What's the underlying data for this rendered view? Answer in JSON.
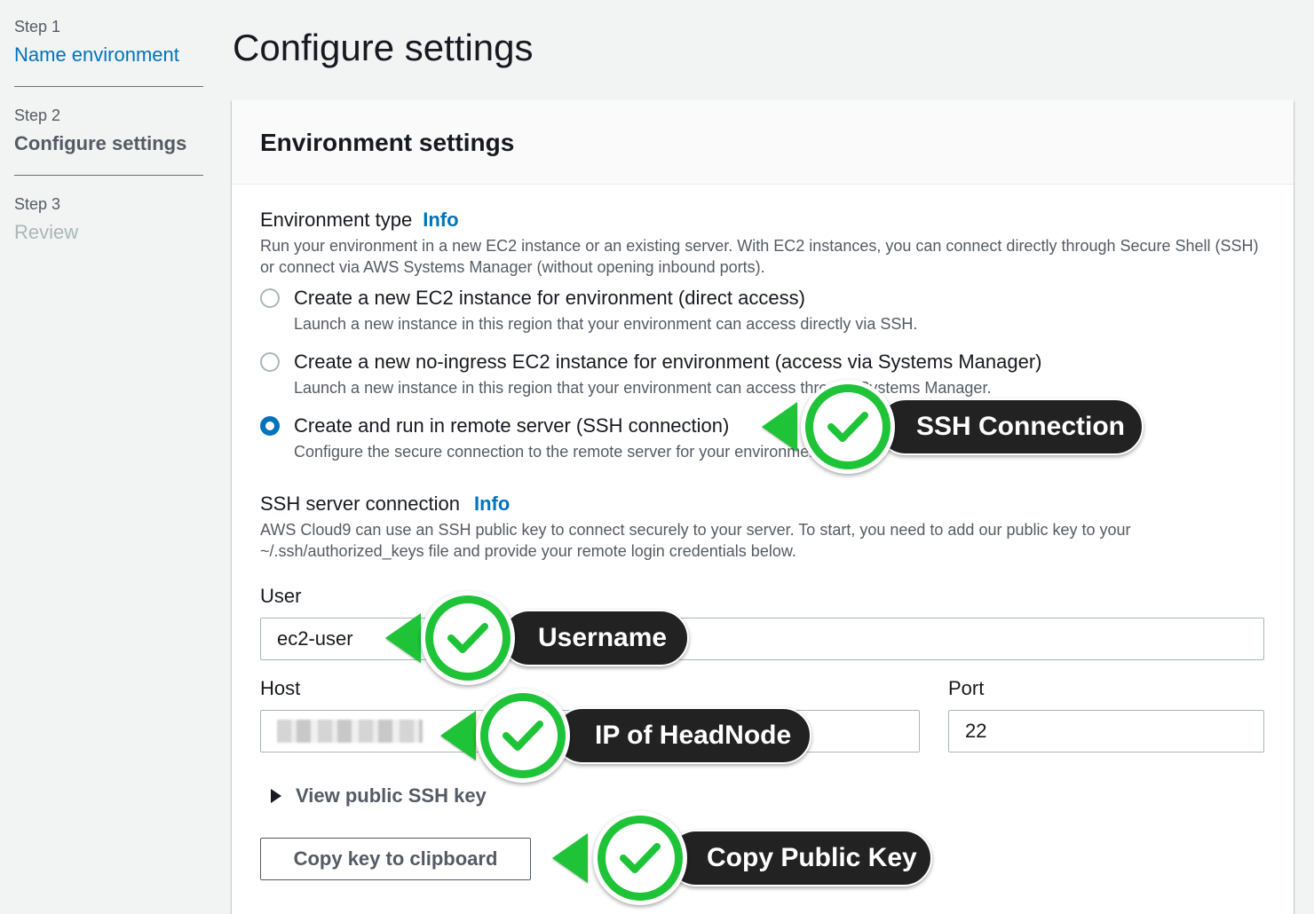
{
  "steps": [
    {
      "num": "Step 1",
      "title": "Name environment"
    },
    {
      "num": "Step 2",
      "title": "Configure settings"
    },
    {
      "num": "Step 3",
      "title": "Review"
    }
  ],
  "page_title": "Configure settings",
  "panel": {
    "title": "Environment settings",
    "env_type": {
      "label": "Environment type",
      "info": "Info",
      "description": "Run your environment in a new EC2 instance or an existing server. With EC2 instances, you can connect directly through Secure Shell (SSH) or connect via AWS Systems Manager (without opening inbound ports).",
      "options": [
        {
          "label": "Create a new EC2 instance for environment (direct access)",
          "desc": "Launch a new instance in this region that your environment can access directly via SSH.",
          "selected": false
        },
        {
          "label": "Create a new no-ingress EC2 instance for environment (access via Systems Manager)",
          "desc": "Launch a new instance in this region that your environment can access through Systems Manager.",
          "selected": false
        },
        {
          "label": "Create and run in remote server (SSH connection)",
          "desc": "Configure the secure connection to the remote server for your environment.",
          "selected": true
        }
      ]
    },
    "ssh": {
      "label": "SSH server connection",
      "info": "Info",
      "description": "AWS Cloud9 can use an SSH public key to connect securely to your server. To start, you need to add our public key to your ~/.ssh/authorized_keys file and provide your remote login credentials below."
    },
    "user": {
      "label": "User",
      "value": "ec2-user"
    },
    "host": {
      "label": "Host",
      "value": ""
    },
    "port": {
      "label": "Port",
      "value": "22"
    },
    "view_key_label": "View public SSH key",
    "copy_button_label": "Copy key to clipboard"
  },
  "callouts": {
    "ssh_connection": "SSH Connection",
    "username": "Username",
    "ip_headnode": "IP of HeadNode",
    "copy_public_key": "Copy Public Key"
  },
  "colors": {
    "link": "#0073bb",
    "callout_green": "#1ec337",
    "callout_dark": "#222222"
  }
}
